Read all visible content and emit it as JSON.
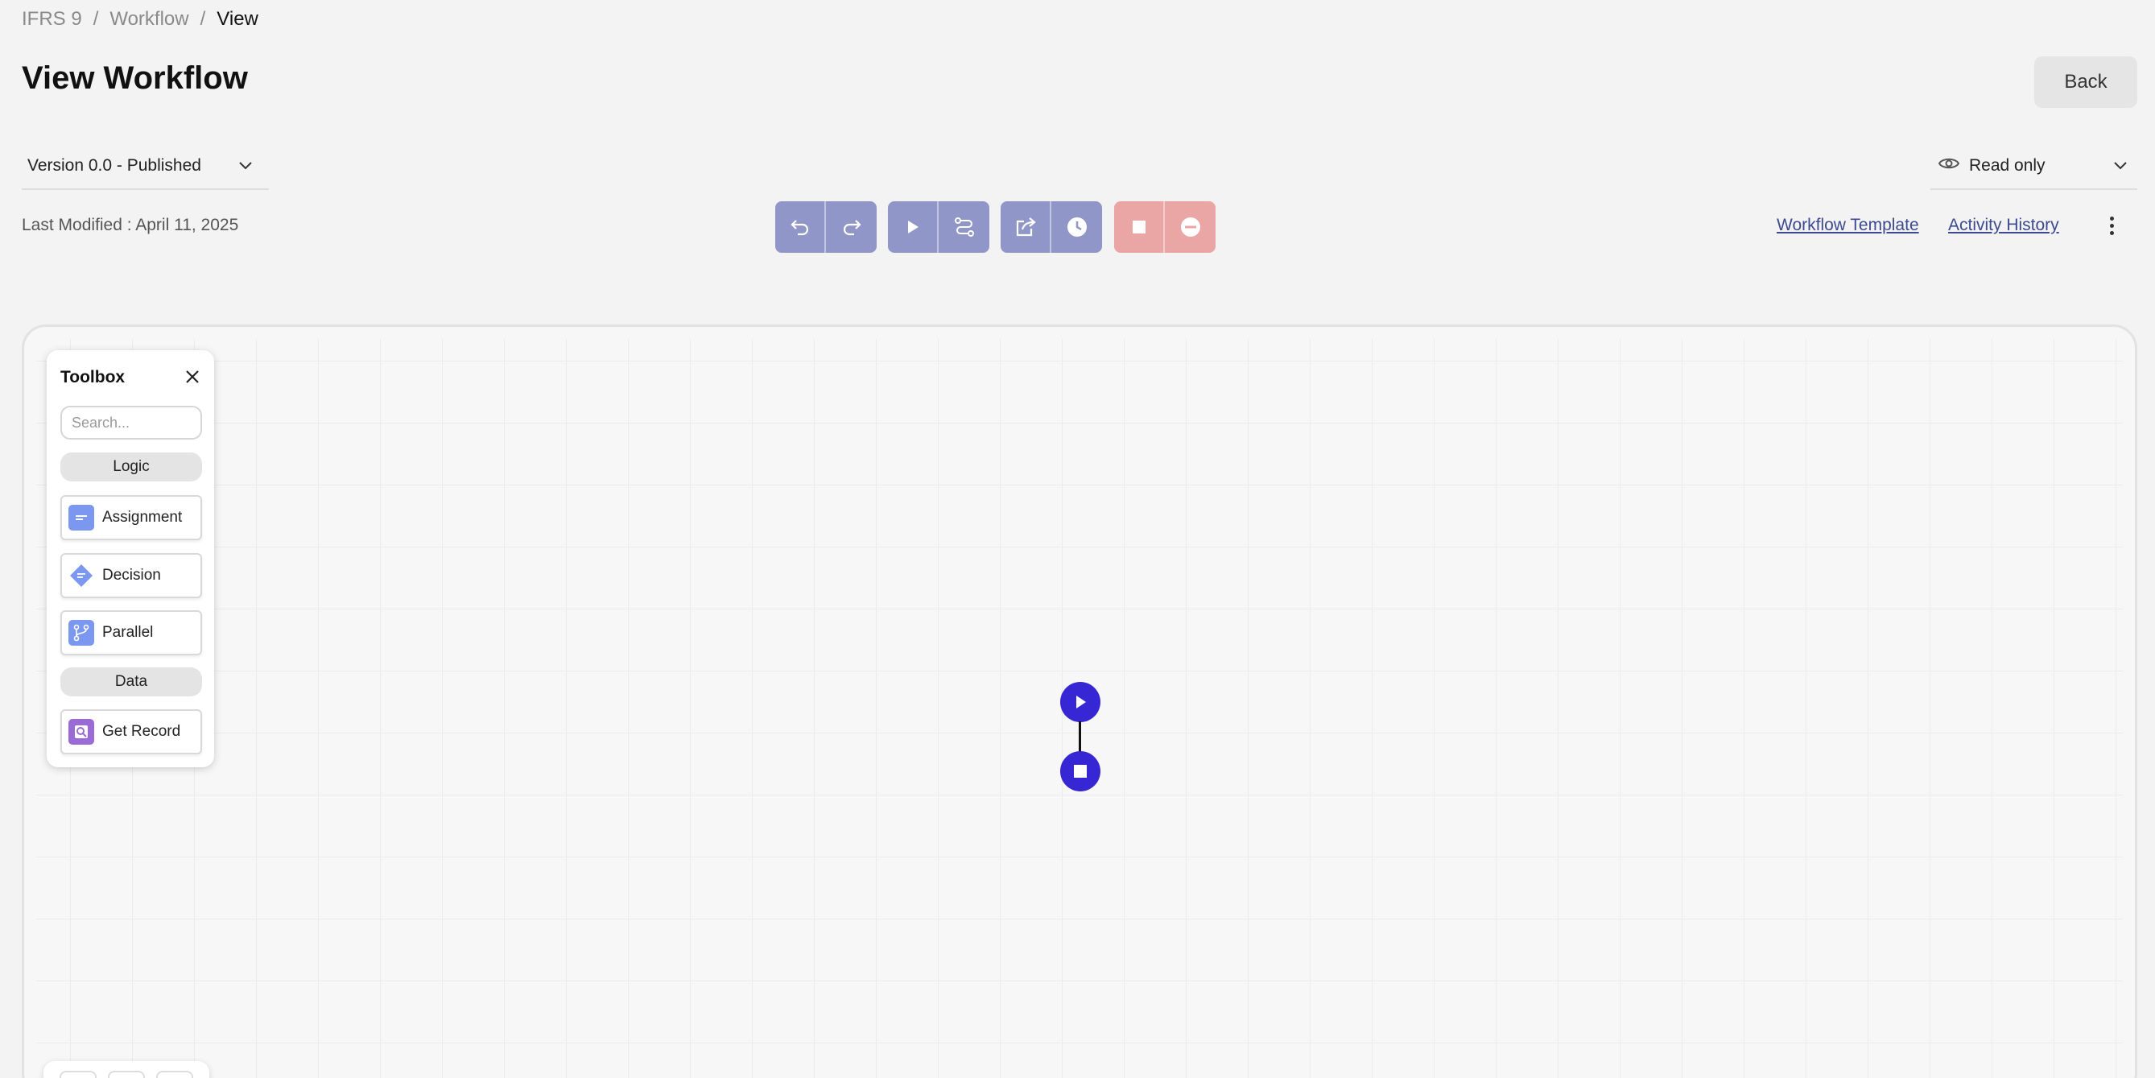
{
  "breadcrumb": {
    "items": [
      "IFRS 9",
      "Workflow"
    ],
    "separator": "/",
    "current": "View"
  },
  "page": {
    "title": "View Workflow",
    "back_label": "Back"
  },
  "version": {
    "selected": "Version 0.0 - Published"
  },
  "mode": {
    "selected": "Read only",
    "icon": "eye-icon"
  },
  "meta": {
    "last_modified": "Last Modified : April 11, 2025"
  },
  "toolbar": {
    "groups": [
      {
        "color": "#9097c8",
        "buttons": [
          "undo-icon",
          "redo-icon"
        ]
      },
      {
        "color": "#9097c8",
        "buttons": [
          "play-icon",
          "route-icon"
        ]
      },
      {
        "color": "#9097c8",
        "buttons": [
          "share-icon",
          "clock-icon"
        ]
      },
      {
        "color": "#e9a6a4",
        "buttons": [
          "stop-icon",
          "remove-icon"
        ]
      }
    ]
  },
  "links": {
    "workflow_template": "Workflow Template",
    "activity_history": "Activity History"
  },
  "toolbox": {
    "title": "Toolbox",
    "search_placeholder": "Search...",
    "sections": [
      {
        "label": "Logic",
        "items": [
          {
            "label": "Assignment",
            "icon": "assignment-icon",
            "color": "#7c97f0"
          },
          {
            "label": "Decision",
            "icon": "decision-icon",
            "color": "#7c97f0"
          },
          {
            "label": "Parallel",
            "icon": "parallel-icon",
            "color": "#7c97f0"
          }
        ]
      },
      {
        "label": "Data",
        "items": [
          {
            "label": "Get Record",
            "icon": "get-record-icon",
            "color": "#9a6bd6"
          }
        ]
      }
    ]
  },
  "flow": {
    "node_color": "#3726d4",
    "nodes": [
      "start-node",
      "end-node"
    ]
  }
}
